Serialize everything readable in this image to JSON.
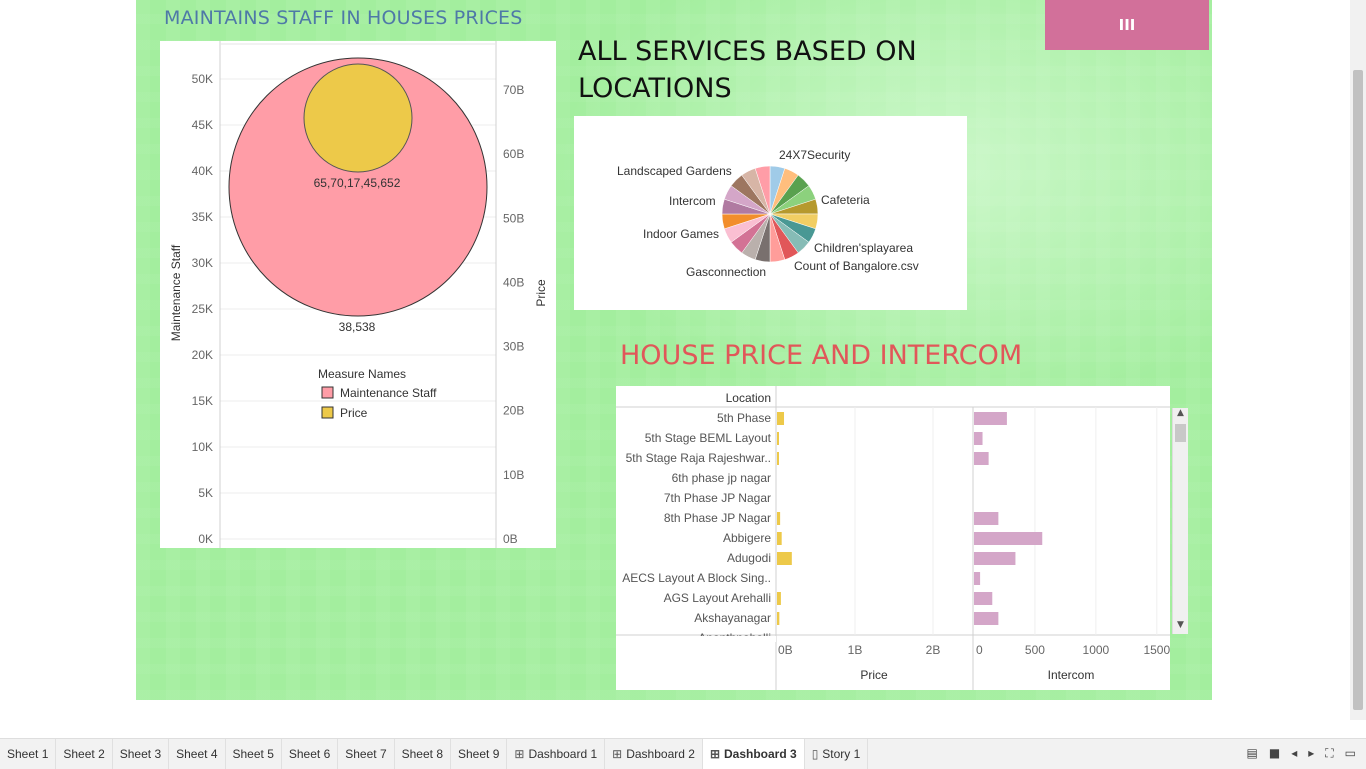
{
  "dashboard": {
    "menu_button": "III",
    "chart1": {
      "title": "MAINTAINS STAFF IN HOUSES PRICES",
      "y_left_label": "Maintenance Staff",
      "y_right_label": "Price",
      "y_left_ticks": [
        "0K",
        "5K",
        "10K",
        "15K",
        "20K",
        "25K",
        "30K",
        "35K",
        "40K",
        "45K",
        "50K"
      ],
      "y_right_ticks": [
        "0B",
        "10B",
        "20B",
        "30B",
        "40B",
        "50B",
        "60B",
        "70B"
      ],
      "big_label": "38,538",
      "small_label": "65,70,17,45,652",
      "legend_title": "Measure Names",
      "legend": [
        {
          "name": "Maintenance Staff",
          "color": "#ff9da7"
        },
        {
          "name": "Price",
          "color": "#edc949"
        }
      ]
    },
    "chart2": {
      "title": "ALL SERVICES BASED ON LOCATIONS",
      "labels": [
        "24X7Security",
        "Cafeteria",
        "Children'splayarea",
        "Count of Bangalore.csv",
        "Gasconnection",
        "Indoor Games",
        "Intercom",
        "Landscaped Gardens"
      ]
    },
    "chart3": {
      "title": "HOUSE PRICE AND INTERCOM",
      "row_header": "Location",
      "col_price": "Price",
      "col_intercom": "Intercom",
      "price_ticks": [
        "0B",
        "1B",
        "2B"
      ],
      "intercom_ticks": [
        "0",
        "500",
        "1000",
        "1500"
      ],
      "rows": [
        "5th Phase",
        "5th Stage BEML Layout",
        "5th Stage Raja Rajeshwar..",
        "6th phase jp nagar",
        "7th Phase JP Nagar",
        "8th Phase JP Nagar",
        "Abbigere",
        "Adugodi",
        "AECS Layout A Block Sing..",
        "AGS Layout Arehalli",
        "Akshayanagar",
        "Ananthnahalli"
      ]
    }
  },
  "chart_data": [
    {
      "type": "scatter",
      "title": "MAINTAINS STAFF IN HOUSES PRICES",
      "ylabel": "Maintenance Staff",
      "y2label": "Price",
      "ylim": [
        0,
        50000
      ],
      "y2lim": [
        0,
        70000000000
      ],
      "series": [
        {
          "name": "Maintenance Staff",
          "values": [
            38538
          ],
          "color": "#ff9da7"
        },
        {
          "name": "Price",
          "values": [
            65701745652
          ],
          "color": "#edc949"
        }
      ]
    },
    {
      "type": "pie",
      "title": "ALL SERVICES BASED ON LOCATIONS",
      "categories": [
        "24X7Security",
        "Cafeteria",
        "Children'splayarea",
        "Count of Bangalore.csv",
        "Gasconnection",
        "Indoor Games",
        "Intercom",
        "Landscaped Gardens"
      ],
      "slice_colors": [
        "#a0cbe8",
        "#ffbe7d",
        "#59a14f",
        "#8cd17d",
        "#b6992d",
        "#f1ce63",
        "#499894",
        "#86bcb6",
        "#e15759",
        "#ff9d9a",
        "#79706e",
        "#bab0ac",
        "#d37295",
        "#fabfd2",
        "#f28e2b",
        "#b07aa1",
        "#d4a6c8",
        "#9d7660",
        "#d7b5a6",
        "#ff9da7"
      ]
    },
    {
      "type": "bar",
      "title": "HOUSE PRICE AND INTERCOM",
      "categories": [
        "5th Phase",
        "5th Stage BEML Layout",
        "5th Stage Raja Rajeshwar..",
        "6th phase jp nagar",
        "7th Phase JP Nagar",
        "8th Phase JP Nagar",
        "Abbigere",
        "Adugodi",
        "AECS Layout A Block Sing..",
        "AGS Layout Arehalli",
        "Akshayanagar"
      ],
      "xlim_price": [
        0,
        2500000000
      ],
      "xlim_intercom": [
        0,
        1600
      ],
      "series": [
        {
          "name": "Price",
          "color": "#edc949",
          "values": [
            90000000,
            20000000,
            25000000,
            0,
            0,
            40000000,
            60000000,
            190000000,
            0,
            50000000,
            30000000
          ]
        },
        {
          "name": "Intercom",
          "color": "#d4a6c8",
          "values": [
            270,
            70,
            120,
            0,
            0,
            200,
            560,
            340,
            50,
            150,
            200
          ]
        }
      ]
    }
  ],
  "tabs": [
    "Sheet 1",
    "Sheet 2",
    "Sheet 3",
    "Sheet 4",
    "Sheet 5",
    "Sheet 6",
    "Sheet 7",
    "Sheet 8",
    "Sheet 9",
    "Dashboard 1",
    "Dashboard 2",
    "Dashboard 3",
    "Story 1"
  ],
  "active_tab": "Dashboard 3"
}
